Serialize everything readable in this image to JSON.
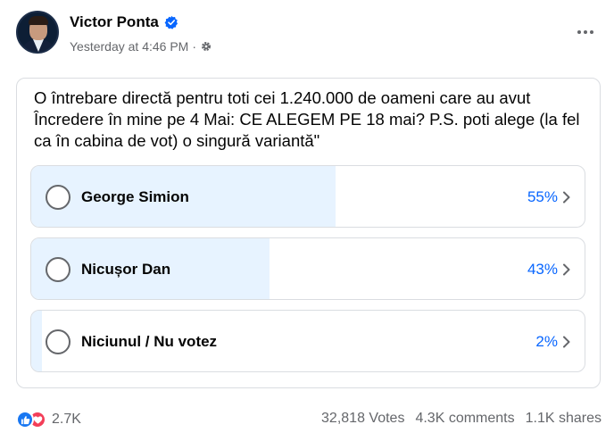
{
  "post": {
    "author": "Victor Ponta",
    "timestamp": "Yesterday at 4:46 PM",
    "separator": "·",
    "verified_icon": "verified-badge-icon",
    "privacy_icon": "gear-icon"
  },
  "poll": {
    "question": "O întrebare directă pentru toti cei 1.240.000 de oameni care au avut Încredere în mine pe 4 Mai: CE ALEGEM PE 18 mai? P.S. poti alege (la fel ca în cabina de vot) o singură variantă\"",
    "options": [
      {
        "label": "George Simion",
        "percent": "55%",
        "fill": 0.55
      },
      {
        "label": "Nicușor Dan",
        "percent": "43%",
        "fill": 0.43
      },
      {
        "label": "Niciunul / Nu votez",
        "percent": "2%",
        "fill": 0.02
      }
    ]
  },
  "footer": {
    "reaction_count": "2.7K",
    "votes": "32,818 Votes",
    "comments": "4.3K comments",
    "shares": "1.1K shares"
  },
  "colors": {
    "accent": "#0866ff",
    "fill": "#e7f3ff",
    "muted": "#65676b",
    "like": "#1877f2",
    "love": "#f33e58"
  }
}
